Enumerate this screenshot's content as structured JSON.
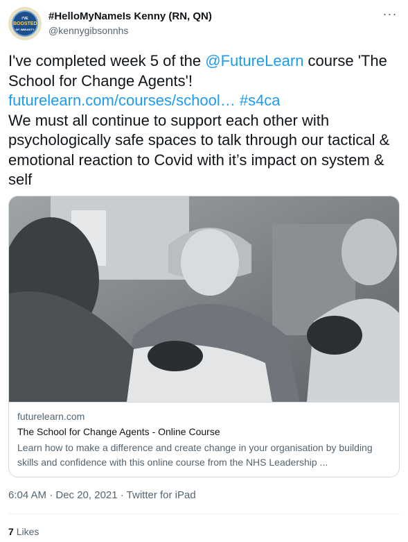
{
  "author": {
    "display_name": "#HelloMyNameIs Kenny (RN, QN)",
    "handle": "@kennygibsonnhs",
    "avatar": {
      "line1": "I'VE",
      "line2": "BOOSTED",
      "line3": "MY IMMUNITY"
    }
  },
  "menu": {
    "more_icon": "more-horizontal-icon",
    "more_glyph": "···"
  },
  "tweet": {
    "segments": [
      {
        "text": "I've completed week 5 of the ",
        "type": "text"
      },
      {
        "text": "@FutureLearn",
        "type": "link"
      },
      {
        "text": " course 'The School for Change Agents'! ",
        "type": "text"
      },
      {
        "text": "futurelearn.com/courses/school…",
        "type": "link"
      },
      {
        "text": " ",
        "type": "text"
      },
      {
        "text": "#s4ca",
        "type": "link"
      },
      {
        "text": "\nWe must all continue to support each other with psychologically safe spaces to talk through our tactical & emotional reaction to Covid with it’s impact on system & self",
        "type": "text"
      }
    ]
  },
  "card": {
    "domain": "futurelearn.com",
    "title": "The School for Change Agents - Online Course",
    "description": "Learn how to make a difference and create change in your organisation by building skills and confidence with this online course from the NHS Leadership ..."
  },
  "meta": {
    "timestamp": "6:04 AM · Dec 20, 2021 · Twitter for iPad"
  },
  "engagement": {
    "likes_count": "7",
    "likes_label": "Likes"
  },
  "colors": {
    "link": "#1d9bf0",
    "text": "#0f1419",
    "muted": "#536471",
    "border": "#cfd9de"
  }
}
